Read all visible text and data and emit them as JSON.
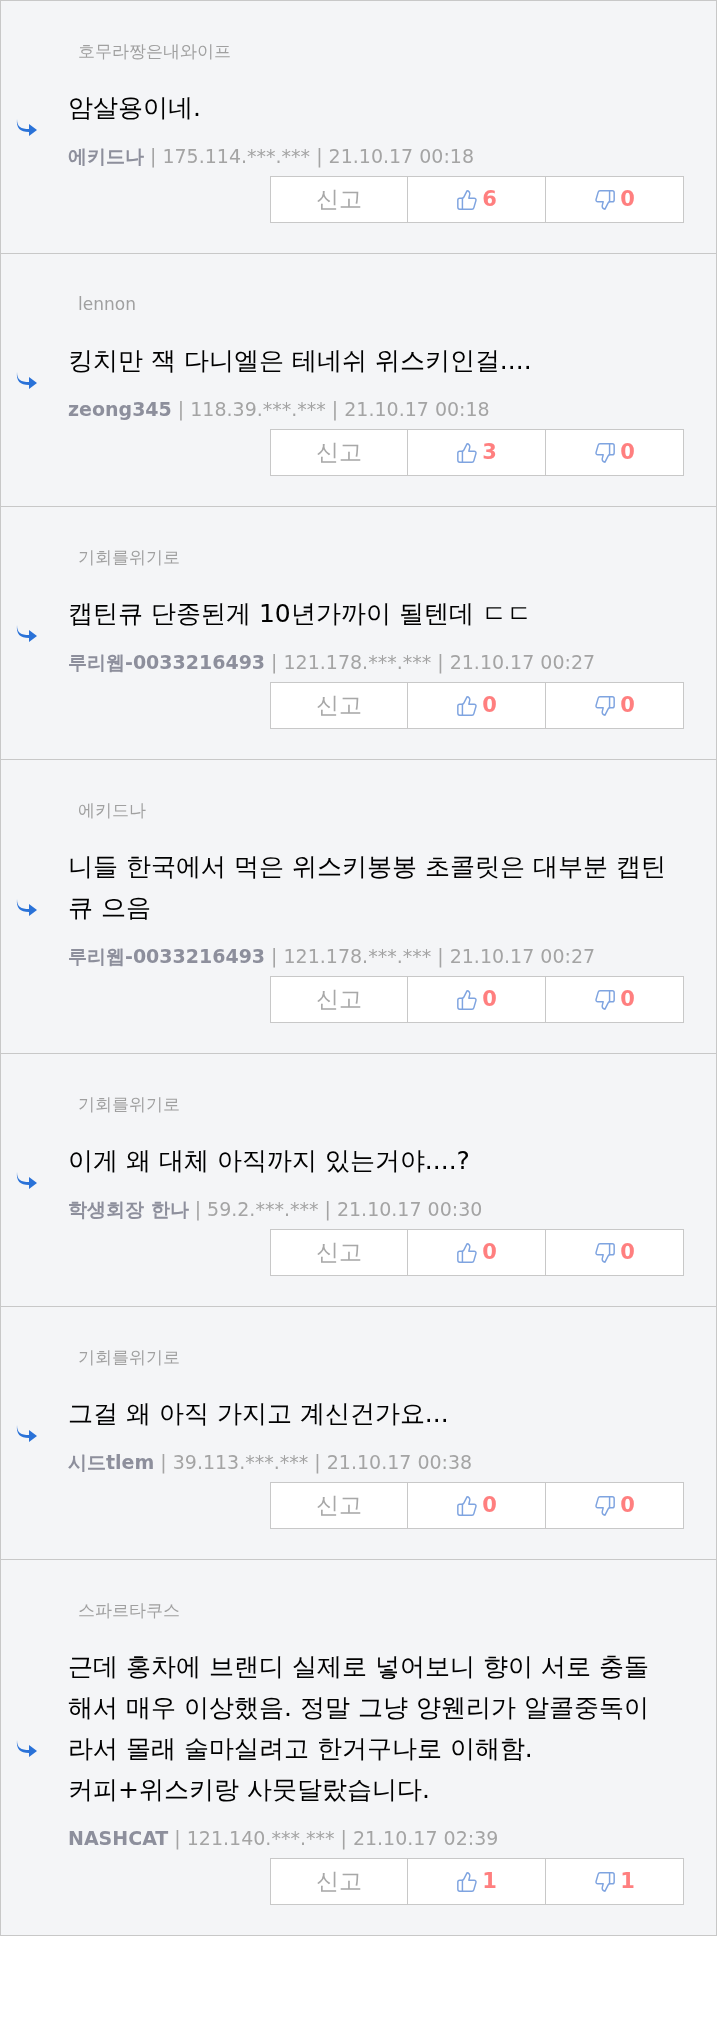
{
  "comments": [
    {
      "reply_to": "호무라짱은내와이프",
      "text": "암살용이네.",
      "author": "에키드나",
      "details": "| 175.114.***.*** | 21.10.17 00:18",
      "report": "신고",
      "likes": "6",
      "dislikes": "0"
    },
    {
      "reply_to": "lennon",
      "text": "킹치만 잭 다니엘은 테네쉬 위스키인걸....",
      "author": "zeong345",
      "details": "| 118.39.***.*** | 21.10.17 00:18",
      "report": "신고",
      "likes": "3",
      "dislikes": "0"
    },
    {
      "reply_to": "기회를위기로",
      "text": "캡틴큐 단종된게 10년가까이 될텐데 ㄷㄷ",
      "author": "루리웹-0033216493",
      "details": "| 121.178.***.*** | 21.10.17 00:27",
      "report": "신고",
      "likes": "0",
      "dislikes": "0"
    },
    {
      "reply_to": "에키드나",
      "text": "니들 한국에서 먹은 위스키봉봉 초콜릿은 대부분 캡틴큐 으음",
      "author": "루리웹-0033216493",
      "details": "| 121.178.***.*** | 21.10.17 00:27",
      "report": "신고",
      "likes": "0",
      "dislikes": "0"
    },
    {
      "reply_to": "기회를위기로",
      "text": "이게 왜 대체 아직까지 있는거야....?",
      "author": "학생회장 한나",
      "details": "| 59.2.***.*** | 21.10.17 00:30",
      "report": "신고",
      "likes": "0",
      "dislikes": "0"
    },
    {
      "reply_to": "기회를위기로",
      "text": "그걸 왜 아직 가지고 계신건가요...",
      "author": "시드tlem",
      "details": "| 39.113.***.*** | 21.10.17 00:38",
      "report": "신고",
      "likes": "0",
      "dislikes": "0"
    },
    {
      "reply_to": "스파르타쿠스",
      "text": "근데 홍차에 브랜디 실제로 넣어보니 향이 서로 충돌해서 매우 이상했음. 정말 그냥 양웬리가 알콜중독이라서 몰래 술마실려고 한거구나로 이해함.\n커피+위스키랑 사뭇달랐습니다.",
      "author": "NASHCAT",
      "details": "| 121.140.***.*** | 21.10.17 02:39",
      "report": "신고",
      "likes": "1",
      "dislikes": "1"
    }
  ]
}
